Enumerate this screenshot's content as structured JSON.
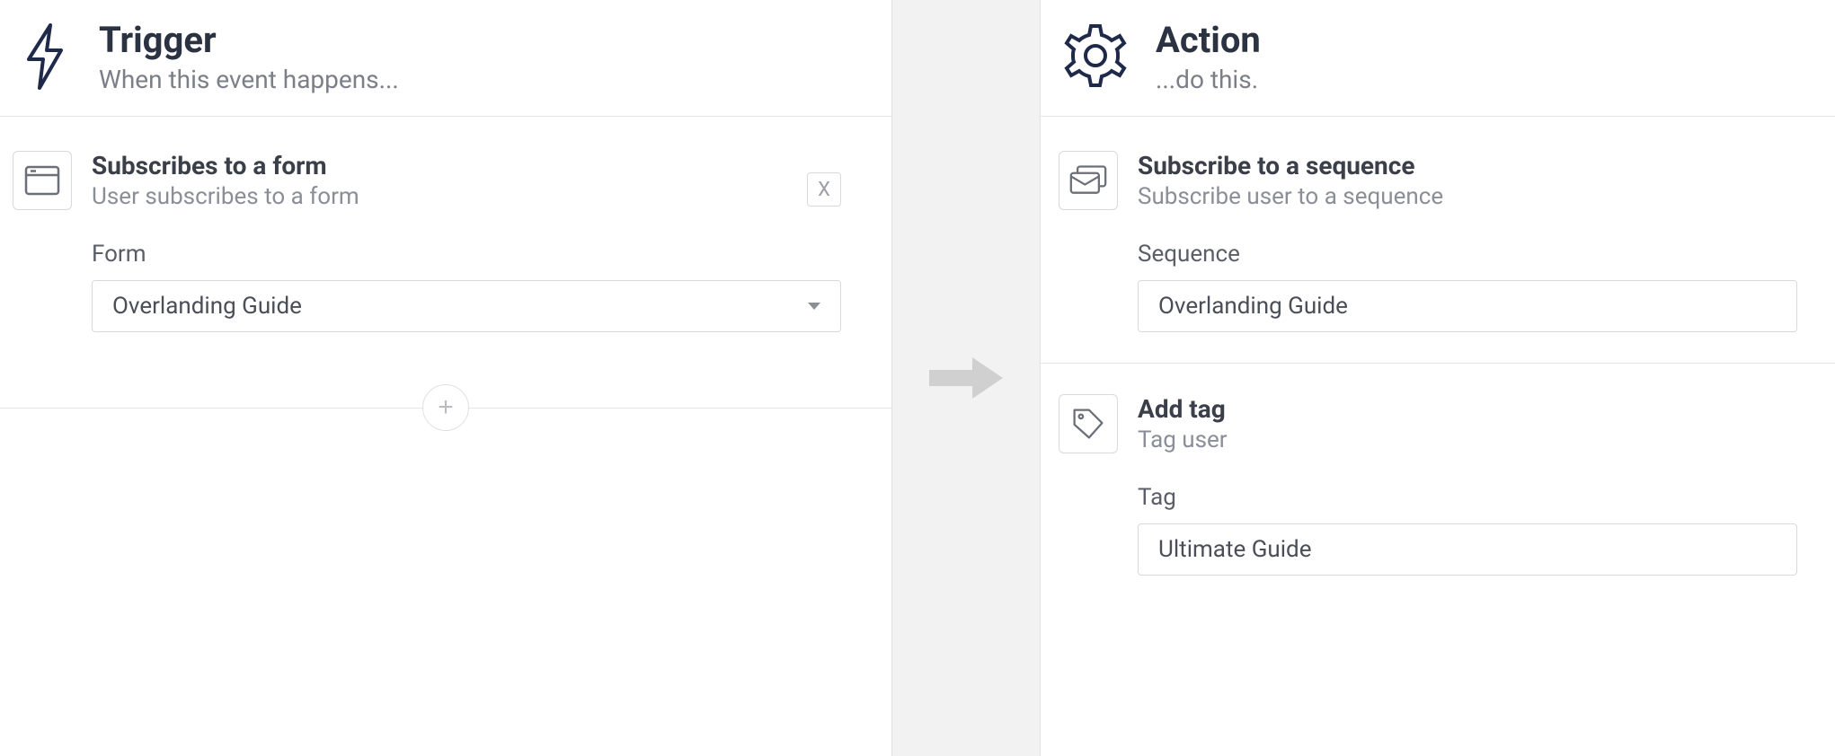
{
  "trigger": {
    "title": "Trigger",
    "subtitle": "When this event happens...",
    "card": {
      "title": "Subscribes to a form",
      "description": "User subscribes to a form",
      "close_label": "X",
      "field_label": "Form",
      "field_value": "Overlanding Guide"
    },
    "add_label": "+"
  },
  "action": {
    "title": "Action",
    "subtitle": "...do this.",
    "items": [
      {
        "title": "Subscribe to a sequence",
        "description": "Subscribe user to a sequence",
        "field_label": "Sequence",
        "field_value": "Overlanding Guide"
      },
      {
        "title": "Add tag",
        "description": "Tag user",
        "field_label": "Tag",
        "field_value": "Ultimate Guide"
      }
    ]
  }
}
